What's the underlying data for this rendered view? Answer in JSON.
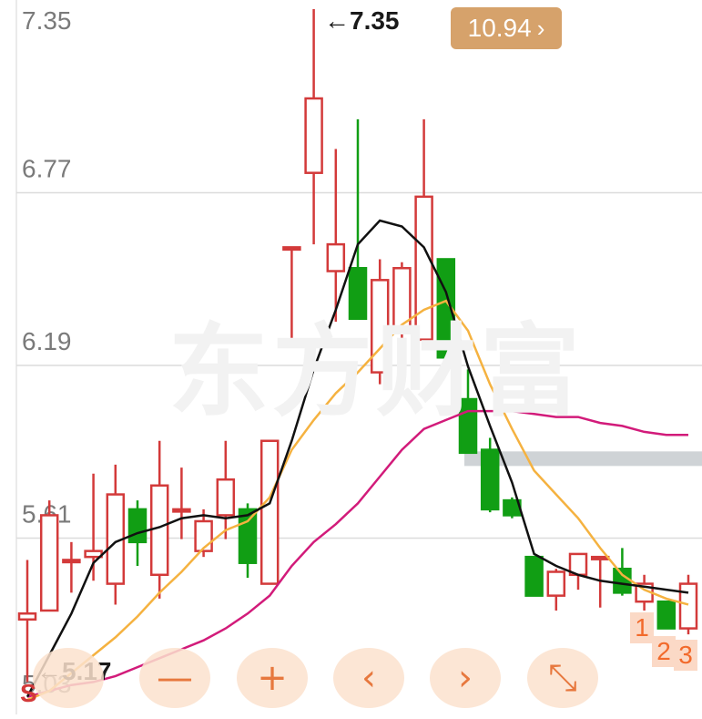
{
  "watermark": "东方财富",
  "price_axis": {
    "labels": [
      "7.35",
      "6.77",
      "6.19",
      "5.61",
      "5.03"
    ]
  },
  "badge": {
    "value": "10.94",
    "chevron": "›"
  },
  "annotations": {
    "high": "←7.35",
    "low": "←5.17",
    "signal": "S"
  },
  "markers": [
    "1",
    "2",
    "3"
  ],
  "controls": [
    {
      "name": "rewind-icon",
      "glyph": ""
    },
    {
      "name": "zoom-out-icon",
      "glyph": "—"
    },
    {
      "name": "zoom-in-icon",
      "glyph": "+"
    },
    {
      "name": "scroll-left-icon",
      "glyph": "‹"
    },
    {
      "name": "scroll-right-icon",
      "glyph": "›"
    },
    {
      "name": "fullscreen-icon",
      "glyph": "⤡"
    }
  ],
  "colors": {
    "up": "#d33a3a",
    "down": "#119e14",
    "ma_black": "#111111",
    "ma_orange": "#f5b240",
    "ma_magenta": "#d21b7a",
    "accent": "#d6a26b",
    "control": "#e7783e"
  },
  "chart_data": {
    "type": "candlestick",
    "ylim": [
      5.03,
      7.35
    ],
    "y_ticks": [
      7.35,
      6.77,
      6.19,
      5.61,
      5.03
    ],
    "candles": [
      {
        "o": 5.3,
        "h": 5.5,
        "l": 5.09,
        "c": 5.32
      },
      {
        "o": 5.33,
        "h": 5.7,
        "l": 5.33,
        "c": 5.65
      },
      {
        "o": 5.5,
        "h": 5.56,
        "l": 5.39,
        "c": 5.5
      },
      {
        "o": 5.51,
        "h": 5.79,
        "l": 5.43,
        "c": 5.53
      },
      {
        "o": 5.42,
        "h": 5.82,
        "l": 5.35,
        "c": 5.72
      },
      {
        "o": 5.67,
        "h": 5.7,
        "l": 5.48,
        "c": 5.56
      },
      {
        "o": 5.45,
        "h": 5.9,
        "l": 5.37,
        "c": 5.75
      },
      {
        "o": 5.67,
        "h": 5.81,
        "l": 5.57,
        "c": 5.67
      },
      {
        "o": 5.53,
        "h": 5.67,
        "l": 5.51,
        "c": 5.63
      },
      {
        "o": 5.65,
        "h": 5.9,
        "l": 5.57,
        "c": 5.77
      },
      {
        "o": 5.67,
        "h": 5.69,
        "l": 5.44,
        "c": 5.49
      },
      {
        "o": 5.42,
        "h": 5.9,
        "l": 5.42,
        "c": 5.9
      },
      {
        "o": 6.55,
        "h": 6.55,
        "l": 6.23,
        "c": 6.55
      },
      {
        "o": 6.8,
        "h": 7.35,
        "l": 6.56,
        "c": 7.05
      },
      {
        "o": 6.47,
        "h": 6.88,
        "l": 6.3,
        "c": 6.56
      },
      {
        "o": 6.48,
        "h": 6.98,
        "l": 6.31,
        "c": 6.31
      },
      {
        "o": 6.13,
        "h": 6.51,
        "l": 6.09,
        "c": 6.44
      },
      {
        "o": 6.28,
        "h": 6.5,
        "l": 6.13,
        "c": 6.48
      },
      {
        "o": 6.24,
        "h": 6.98,
        "l": 6.21,
        "c": 6.72
      },
      {
        "o": 6.51,
        "h": 6.51,
        "l": 6.19,
        "c": 6.18
      },
      {
        "o": 6.04,
        "h": 6.14,
        "l": 5.92,
        "c": 5.86
      },
      {
        "o": 5.87,
        "h": 5.91,
        "l": 5.66,
        "c": 5.67
      },
      {
        "o": 5.7,
        "h": 5.71,
        "l": 5.64,
        "c": 5.65
      },
      {
        "o": 5.51,
        "h": 5.51,
        "l": 5.39,
        "c": 5.38
      },
      {
        "o": 5.38,
        "h": 5.47,
        "l": 5.33,
        "c": 5.46
      },
      {
        "o": 5.45,
        "h": 5.51,
        "l": 5.4,
        "c": 5.52
      },
      {
        "o": 5.51,
        "h": 5.51,
        "l": 5.34,
        "c": 5.51
      },
      {
        "o": 5.47,
        "h": 5.54,
        "l": 5.38,
        "c": 5.39
      },
      {
        "o": 5.36,
        "h": 5.45,
        "l": 5.33,
        "c": 5.42
      },
      {
        "o": 5.36,
        "h": 5.36,
        "l": 5.28,
        "c": 5.27
      },
      {
        "o": 5.27,
        "h": 5.45,
        "l": 5.25,
        "c": 5.42
      }
    ],
    "ma_black": [
      5.04,
      5.18,
      5.32,
      5.49,
      5.56,
      5.59,
      5.61,
      5.64,
      5.65,
      5.64,
      5.65,
      5.69,
      5.9,
      6.14,
      6.34,
      6.56,
      6.64,
      6.62,
      6.55,
      6.4,
      6.15,
      5.95,
      5.76,
      5.52,
      5.48,
      5.45,
      5.43,
      5.42,
      5.41,
      5.4,
      5.39
    ],
    "ma_orange": [
      5.03,
      5.06,
      5.12,
      5.18,
      5.24,
      5.31,
      5.39,
      5.46,
      5.54,
      5.6,
      5.63,
      5.71,
      5.87,
      5.97,
      6.06,
      6.13,
      6.21,
      6.29,
      6.34,
      6.37,
      6.27,
      6.09,
      5.94,
      5.8,
      5.72,
      5.64,
      5.54,
      5.45,
      5.4,
      5.37,
      5.35
    ],
    "ma_magenta": [
      5.04,
      5.06,
      5.08,
      5.09,
      5.11,
      5.14,
      5.17,
      5.2,
      5.23,
      5.27,
      5.32,
      5.38,
      5.48,
      5.56,
      5.62,
      5.69,
      5.78,
      5.87,
      5.94,
      5.97,
      6.0,
      6.0,
      6.0,
      5.99,
      5.98,
      5.98,
      5.96,
      5.95,
      5.93,
      5.92,
      5.92
    ],
    "resistance_level": 5.84
  }
}
